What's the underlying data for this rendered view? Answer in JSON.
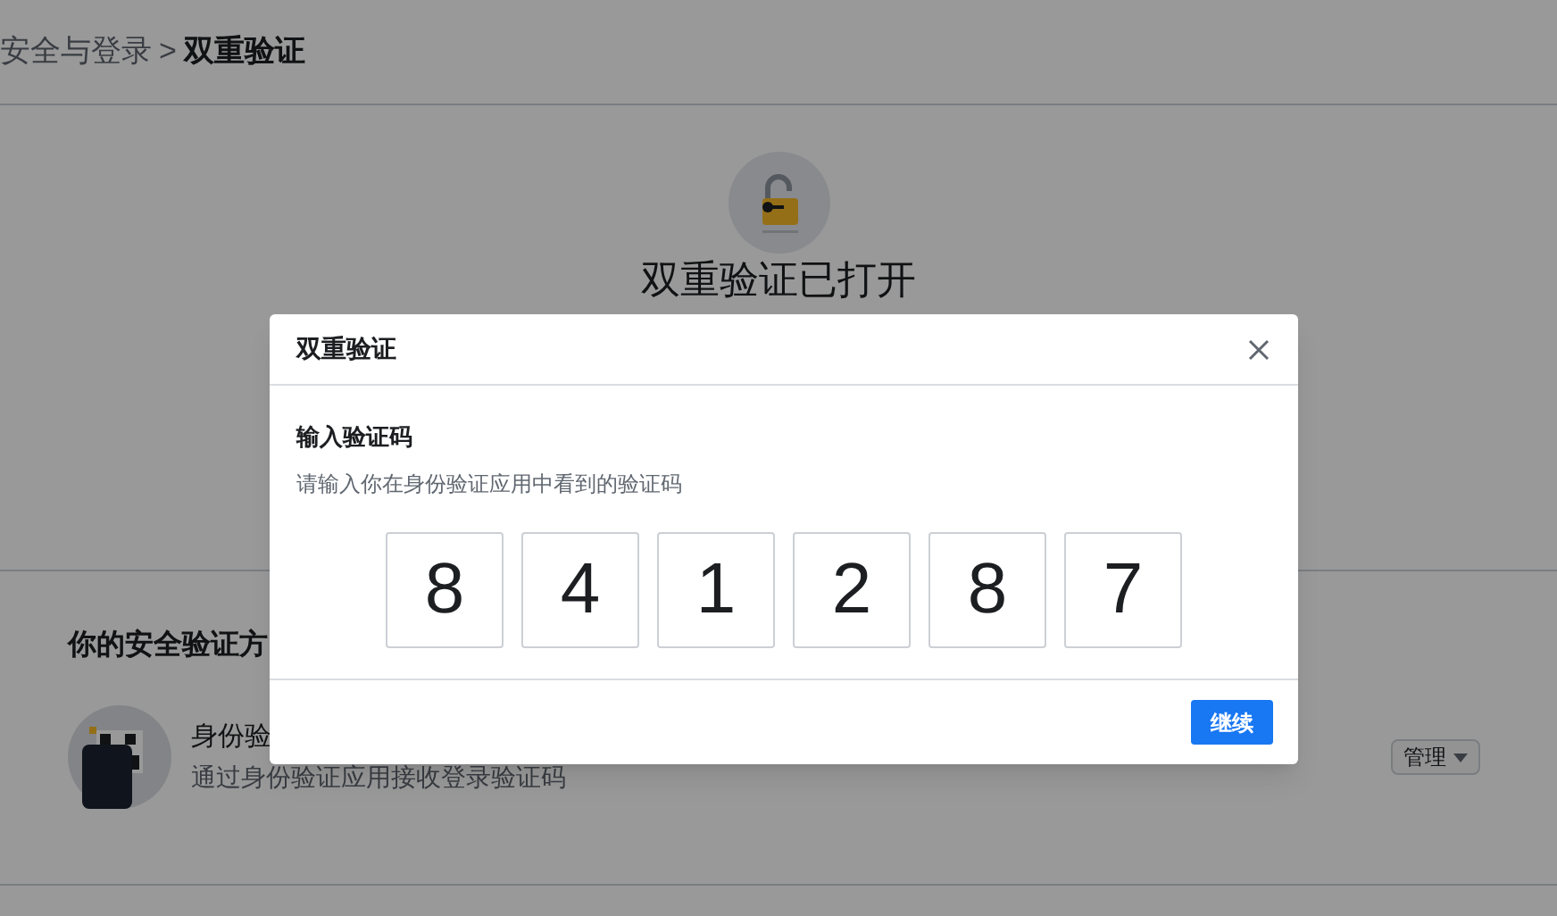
{
  "breadcrumb": {
    "parent": "安全与登录",
    "separator": ">",
    "current": "双重验证"
  },
  "status_title": "双重验证已打开",
  "methods_section": {
    "title": "你的安全验证方",
    "items": [
      {
        "title": "身份验",
        "subtitle": "通过身份验证应用接收登录验证码",
        "action": "管理"
      }
    ]
  },
  "dialog": {
    "title": "双重验证",
    "heading": "输入验证码",
    "hint": "请输入你在身份验证应用中看到的验证码",
    "digits": [
      "8",
      "4",
      "1",
      "2",
      "8",
      "7"
    ],
    "primary_button": "继续"
  }
}
